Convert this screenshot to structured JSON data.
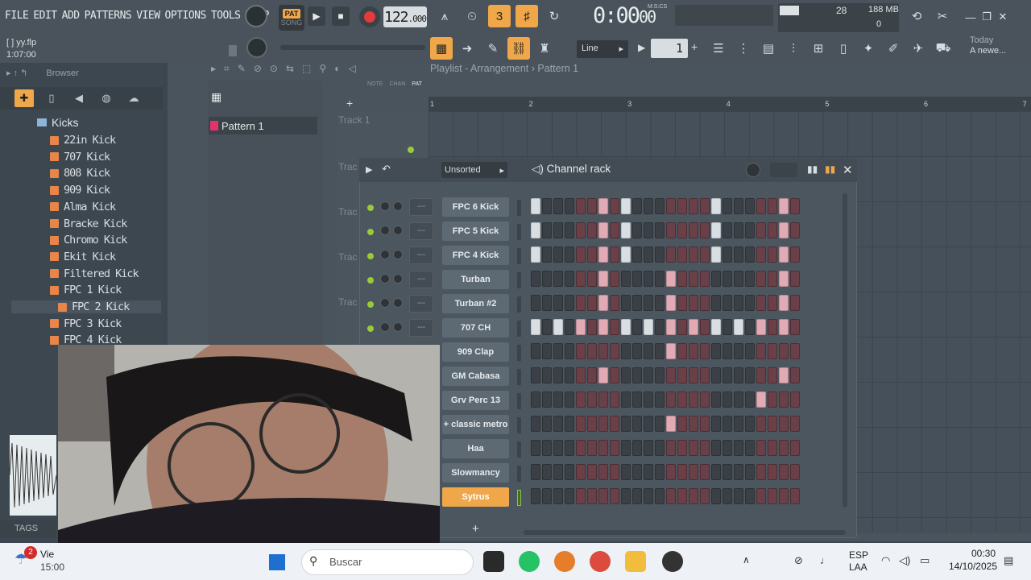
{
  "menu": [
    "FILE",
    "EDIT",
    "ADD",
    "PATTERNS",
    "VIEW",
    "OPTIONS",
    "TOOLS",
    "HELP"
  ],
  "transport": {
    "pat": "PAT",
    "song": "SONG",
    "tempo_int": "122",
    "tempo_dec": ".000",
    "time": "0:00",
    "time_cs": "00",
    "mscs_label": "M:S:CS"
  },
  "system": {
    "cpu": "28",
    "mem": "188 MB",
    "poly": "0"
  },
  "project": {
    "name": "yy.flp",
    "time": "1:07:00",
    "prefix": "[ ]"
  },
  "snap": "Line",
  "pattern_number": "1",
  "news": {
    "line1": "Today",
    "line2": "A newe..."
  },
  "browser": {
    "title": "Browser",
    "folder": "Kicks",
    "items": [
      "22in Kick",
      "707 Kick",
      "808 Kick",
      "909 Kick",
      "Alma Kick",
      "Bracke Kick",
      "Chromo Kick",
      "Ekit Kick",
      "Filtered Kick",
      "FPC 1 Kick",
      "FPC 2 Kick",
      "FPC 3 Kick",
      "FPC 4 Kick"
    ],
    "selected": "FPC 2 Kick",
    "tags": "TAGS"
  },
  "playlist": {
    "title": "Playlist - Arrangement",
    "pattern": "Pattern 1",
    "pattern_item": "Pattern 1",
    "timeline": [
      "1",
      "2",
      "3",
      "4",
      "5",
      "6",
      "7"
    ],
    "track1": "Track 1",
    "track_short": "Trac",
    "ntp": [
      "NOTE",
      "CHAN",
      "PAT"
    ]
  },
  "rack": {
    "filter": "Unsorted",
    "title": "Channel rack",
    "channels": [
      {
        "name": "FPC 6 Kick",
        "steps": [
          1,
          0,
          0,
          0,
          0,
          0,
          1,
          0,
          1,
          0,
          0,
          0,
          0,
          0,
          0,
          0,
          1,
          0,
          0,
          0,
          0,
          0,
          1,
          0
        ]
      },
      {
        "name": "FPC 5 Kick",
        "steps": [
          1,
          0,
          0,
          0,
          0,
          0,
          1,
          0,
          1,
          0,
          0,
          0,
          0,
          0,
          0,
          0,
          1,
          0,
          0,
          0,
          0,
          0,
          1,
          0
        ]
      },
      {
        "name": "FPC 4 Kick",
        "steps": [
          1,
          0,
          0,
          0,
          0,
          0,
          1,
          0,
          1,
          0,
          0,
          0,
          0,
          0,
          0,
          0,
          1,
          0,
          0,
          0,
          0,
          0,
          1,
          0
        ]
      },
      {
        "name": "Turban",
        "steps": [
          0,
          0,
          0,
          0,
          0,
          0,
          1,
          0,
          0,
          0,
          0,
          0,
          1,
          0,
          0,
          0,
          0,
          0,
          0,
          0,
          0,
          0,
          1,
          0
        ]
      },
      {
        "name": "Turban #2",
        "steps": [
          0,
          0,
          0,
          0,
          0,
          0,
          1,
          0,
          0,
          0,
          0,
          0,
          1,
          0,
          0,
          0,
          0,
          0,
          0,
          0,
          0,
          0,
          1,
          0
        ]
      },
      {
        "name": "707 CH",
        "steps": [
          1,
          0,
          1,
          0,
          1,
          0,
          1,
          0,
          1,
          0,
          1,
          0,
          1,
          0,
          1,
          0,
          1,
          0,
          1,
          0,
          1,
          0,
          1,
          0
        ]
      },
      {
        "name": "909 Clap",
        "steps": [
          0,
          0,
          0,
          0,
          0,
          0,
          0,
          0,
          0,
          0,
          0,
          0,
          1,
          0,
          0,
          0,
          0,
          0,
          0,
          0,
          0,
          0,
          0,
          0
        ]
      },
      {
        "name": "GM Cabasa",
        "steps": [
          0,
          0,
          0,
          0,
          0,
          0,
          1,
          0,
          0,
          0,
          0,
          0,
          0,
          0,
          0,
          0,
          0,
          0,
          0,
          0,
          0,
          0,
          1,
          0
        ]
      },
      {
        "name": "Grv Perc 13",
        "steps": [
          0,
          0,
          0,
          0,
          0,
          0,
          0,
          0,
          0,
          0,
          0,
          0,
          0,
          0,
          0,
          0,
          0,
          0,
          0,
          0,
          1,
          0,
          0,
          0
        ]
      },
      {
        "name": "+ classic metro",
        "steps": [
          0,
          0,
          0,
          0,
          0,
          0,
          0,
          0,
          0,
          0,
          0,
          0,
          1,
          0,
          0,
          0,
          0,
          0,
          0,
          0,
          0,
          0,
          0,
          0
        ]
      },
      {
        "name": "Haa",
        "steps": [
          0,
          0,
          0,
          0,
          0,
          0,
          0,
          0,
          0,
          0,
          0,
          0,
          0,
          0,
          0,
          0,
          0,
          0,
          0,
          0,
          0,
          0,
          0,
          0
        ]
      },
      {
        "name": "Slowmancy",
        "steps": [
          0,
          0,
          0,
          0,
          0,
          0,
          0,
          0,
          0,
          0,
          0,
          0,
          0,
          0,
          0,
          0,
          0,
          0,
          0,
          0,
          0,
          0,
          0,
          0
        ]
      },
      {
        "name": "Sytrus",
        "steps": [
          0,
          0,
          0,
          0,
          0,
          0,
          0,
          0,
          0,
          0,
          0,
          0,
          0,
          0,
          0,
          0,
          0,
          0,
          0,
          0,
          0,
          0,
          0,
          0
        ]
      }
    ],
    "selected": "Sytrus",
    "mute_label": "---"
  },
  "taskbar": {
    "notif_badge": "2",
    "notif_name": "Vie",
    "notif_time": "15:00",
    "search": "Buscar",
    "lang1": "ESP",
    "lang2": "LAA",
    "time": "00:30",
    "date": "14/10/2025"
  }
}
